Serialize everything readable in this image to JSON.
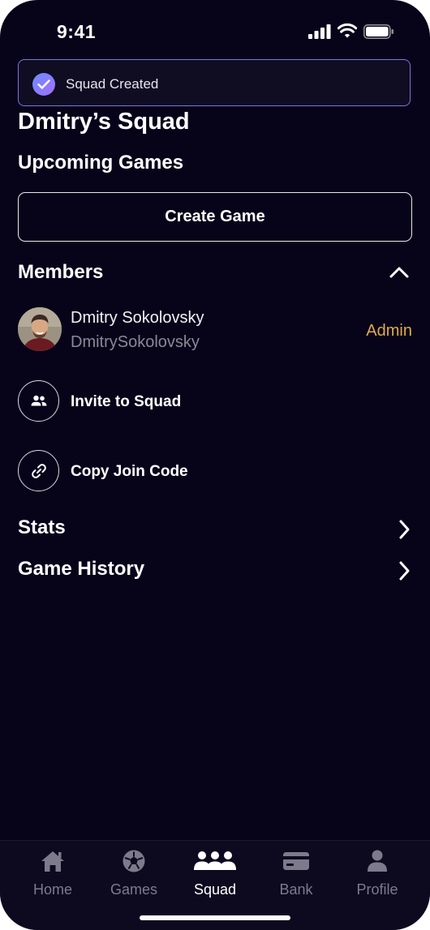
{
  "status_bar": {
    "time": "9:41"
  },
  "toast": {
    "message": "Squad Created"
  },
  "squad": {
    "title": "Dmitry’s Squad"
  },
  "upcoming": {
    "title": "Upcoming Games",
    "create_button": "Create Game"
  },
  "members": {
    "title": "Members",
    "list": [
      {
        "name": "Dmitry Sokolovsky",
        "handle": "DmitrySokolovsky",
        "role": "Admin"
      }
    ],
    "invite_label": "Invite to Squad",
    "copy_code_label": "Copy Join Code"
  },
  "sections": {
    "stats": "Stats",
    "history": "Game History"
  },
  "tabs": [
    {
      "label": "Home",
      "icon": "home-icon"
    },
    {
      "label": "Games",
      "icon": "soccer-ball-icon"
    },
    {
      "label": "Squad",
      "icon": "group-icon",
      "active": true
    },
    {
      "label": "Bank",
      "icon": "card-icon"
    },
    {
      "label": "Profile",
      "icon": "person-icon"
    }
  ],
  "colors": {
    "background": "#07041a",
    "accent_role": "#e3a94a",
    "toast_border": "#7c73e6"
  }
}
